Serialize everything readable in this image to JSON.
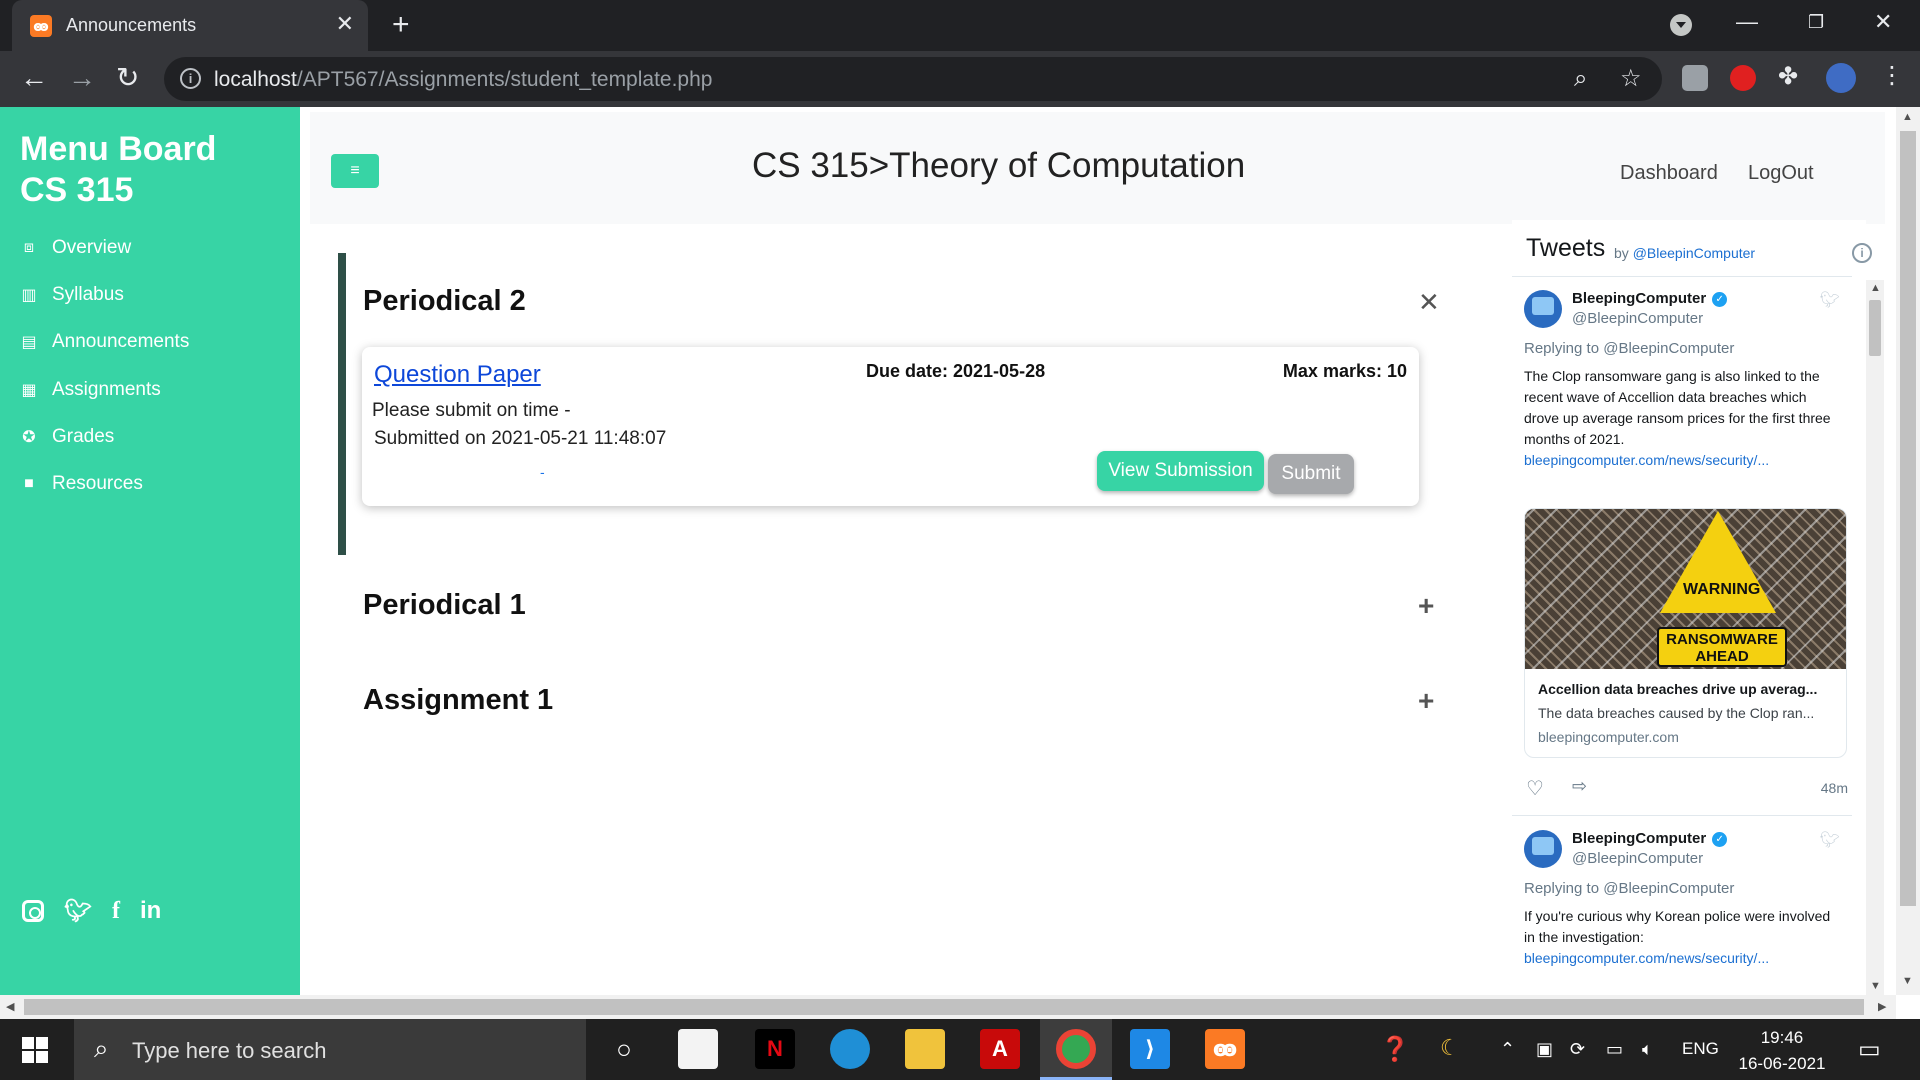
{
  "browser": {
    "tab_title": "Announcements",
    "new_tab": "+",
    "url_host": "localhost",
    "url_path": "/APT567/Assignments/student_template.php"
  },
  "sidebar": {
    "brand_line1": "Menu Board",
    "brand_line2": "CS 315",
    "items": [
      {
        "label": "Overview",
        "icon": "box-icon"
      },
      {
        "label": "Syllabus",
        "icon": "book-icon"
      },
      {
        "label": "Announcements",
        "icon": "chat-icon"
      },
      {
        "label": "Assignments",
        "icon": "document-icon"
      },
      {
        "label": "Grades",
        "icon": "award-icon"
      },
      {
        "label": "Resources",
        "icon": "folder-icon"
      }
    ],
    "socials": [
      "instagram-icon",
      "twitter-icon",
      "facebook-icon",
      "linkedin-icon"
    ]
  },
  "header": {
    "title": "CS 315>Theory of Computation",
    "nav": [
      "Dashboard",
      "LogOut"
    ]
  },
  "sections": [
    {
      "title": "Periodical 2",
      "toggle": "✕",
      "expanded": true
    },
    {
      "title": "Periodical 1",
      "toggle": "+",
      "expanded": false
    },
    {
      "title": "Assignment 1",
      "toggle": "+",
      "expanded": false
    }
  ],
  "card": {
    "link": "Question Paper",
    "due": "Due date: 2021-05-28",
    "max": "Max marks: 10",
    "note": "Please submit on time -",
    "submitted": "Submitted on 2021-05-21 11:48:07",
    "dash": "-",
    "view_button": "View Submission",
    "submit_button": "Submit"
  },
  "tweets_widget": {
    "heading": "Tweets",
    "by": "by",
    "handle": "@BleepinComputer",
    "tweets": [
      {
        "name": "BleepingComputer",
        "handle": "@BleepinComputer",
        "reply": "Replying to @BleepinComputer",
        "text": "The Clop ransomware gang is also linked to the recent wave of Accellion data breaches which drove up average ransom prices for the first three months of 2021.",
        "link": "bleepingcomputer.com/news/security/..."
      },
      {
        "name": "BleepingComputer",
        "handle": "@BleepinComputer",
        "reply": "Replying to @BleepinComputer",
        "text": "If you're curious why Korean police were involved in the investigation:",
        "link": "bleepingcomputer.com/news/security/..."
      }
    ],
    "card": {
      "image_word": "WARNING",
      "image_sign": "RANSOMWARE AHEAD",
      "title": "Accellion data breaches drive up averag...",
      "desc": "The data breaches caused by the Clop ran...",
      "domain": "bleepingcomputer.com"
    },
    "time": "48m"
  },
  "taskbar": {
    "search_placeholder": "Type here to search",
    "lang": "ENG",
    "time": "19:46",
    "date": "16-06-2021"
  }
}
